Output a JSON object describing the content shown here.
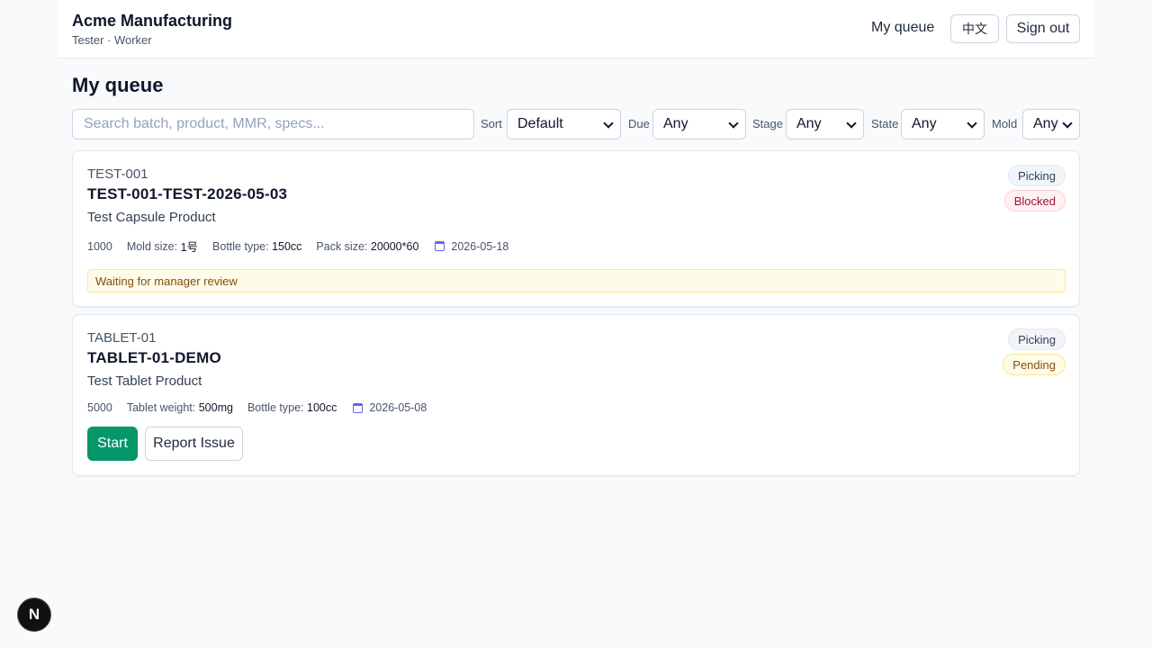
{
  "header": {
    "company": "Acme Manufacturing",
    "user_line": "Tester · Worker",
    "nav_my_queue": "My queue",
    "lang_button": "中文",
    "sign_out": "Sign out"
  },
  "page": {
    "title": "My queue"
  },
  "filters": {
    "search_placeholder": "Search batch, product, MMR, specs...",
    "sort": {
      "label": "Sort",
      "value": "Default"
    },
    "due": {
      "label": "Due",
      "value": "Any"
    },
    "stage": {
      "label": "Stage",
      "value": "Any"
    },
    "state": {
      "label": "State",
      "value": "Any"
    },
    "mold": {
      "label": "Mold",
      "value": "Any"
    }
  },
  "cards": [
    {
      "code": "TEST-001",
      "batch": "TEST-001-TEST-2026-05-03",
      "product": "Test Capsule Product",
      "quantity": "1000",
      "specs": [
        {
          "label": "Mold size:",
          "value": "1号"
        },
        {
          "label": "Bottle type:",
          "value": "150cc"
        },
        {
          "label": "Pack size:",
          "value": "20000*60"
        }
      ],
      "due_date": "2026-05-18",
      "stage_badge": "Picking",
      "state_badge": "Blocked",
      "notice": "Waiting for manager review"
    },
    {
      "code": "TABLET-01",
      "batch": "TABLET-01-DEMO",
      "product": "Test Tablet Product",
      "quantity": "5000",
      "specs": [
        {
          "label": "Tablet weight:",
          "value": "500mg"
        },
        {
          "label": "Bottle type:",
          "value": "100cc"
        }
      ],
      "due_date": "2026-05-08",
      "stage_badge": "Picking",
      "state_badge": "Pending",
      "start_label": "Start",
      "report_label": "Report Issue"
    }
  ],
  "devtools": {
    "label": "N"
  },
  "colors": {
    "accent_green": "#059669",
    "blocked": "#9f1239",
    "pending": "#854d0e",
    "background": "#f8fafc"
  }
}
